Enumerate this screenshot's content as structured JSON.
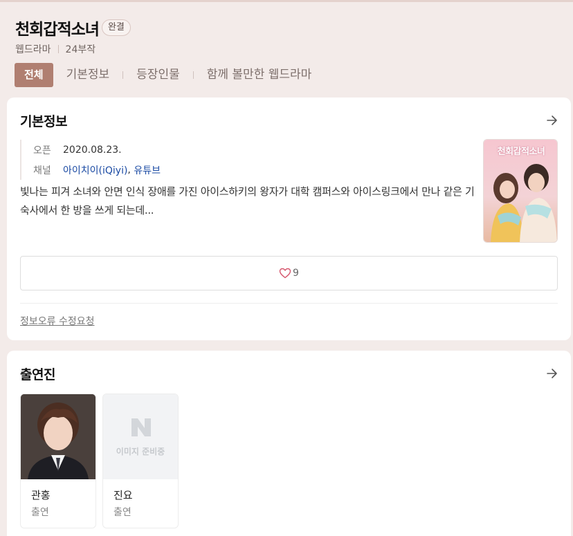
{
  "drama": {
    "title": "천회갑적소녀",
    "status": "완결",
    "genre": "웹드라마",
    "episodes": "24부작"
  },
  "tabs": {
    "all": "전체",
    "basic": "기본정보",
    "cast": "등장인물",
    "related": "함께 볼만한 웹드라마"
  },
  "info_card": {
    "title": "기본정보",
    "open_label": "오픈",
    "open_value": "2020.08.23.",
    "channel_label": "채널",
    "channel_1": "아이치이(iQiyi)",
    "channel_sep": ", ",
    "channel_2": "유튜브",
    "description": "빛나는 피겨 소녀와 안면 인식 장애를 가진 아이스하키의 왕자가 대학 캠퍼스와 아이스링크에서 만나 같은 기숙사에서 한 방을 쓰게 되는데...",
    "poster_text": "천회갑적소녀",
    "likes": "9",
    "report_link": "정보오류 수정요청"
  },
  "cast_card": {
    "title": "출연진",
    "members": [
      {
        "name": "관홍",
        "role": "출연"
      },
      {
        "name": "진요",
        "role": "출연",
        "placeholder_logo": "N",
        "placeholder_text": "이미지 준비중"
      }
    ]
  },
  "colors": {
    "background": "#f3ebe9",
    "accent": "#b07f71",
    "link": "#1a4aa3"
  }
}
